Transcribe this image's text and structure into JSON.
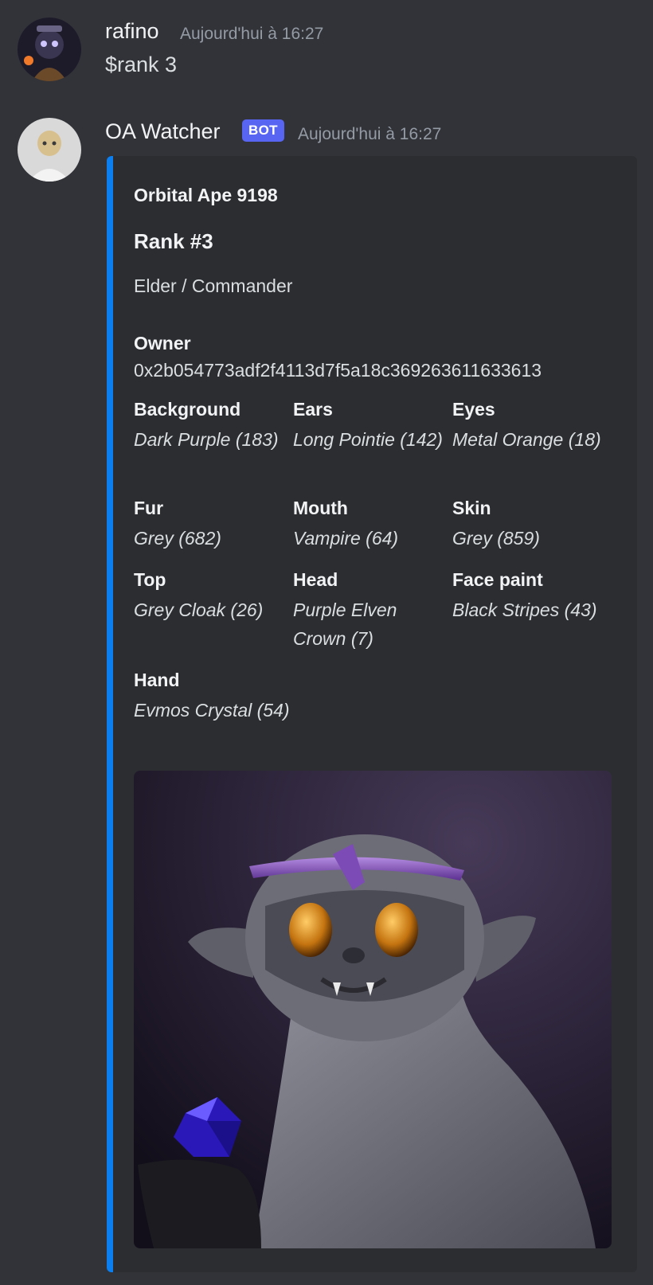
{
  "messages": [
    {
      "author": "rafino",
      "timestamp": "Aujourd'hui à 16:27",
      "content": "$rank 3"
    },
    {
      "author": "OA Watcher",
      "bot_tag": "BOT",
      "timestamp": "Aujourd'hui à 16:27",
      "embed": {
        "color": "#0b7ff0",
        "author": "Orbital Ape 9198",
        "title": "Rank #3",
        "description": "Elder / Commander",
        "owner": {
          "name": "Owner",
          "value": "0x2b054773adf2f4113d7f5a18c369263611633613"
        },
        "fields": [
          {
            "name": "Background",
            "value": "Dark Purple (183)"
          },
          {
            "name": "Ears",
            "value": "Long Pointie (142)"
          },
          {
            "name": "Eyes",
            "value": "Metal Orange (18)"
          },
          {
            "name": "Fur",
            "value": "Grey (682)"
          },
          {
            "name": "Mouth",
            "value": "Vampire (64)"
          },
          {
            "name": "Skin",
            "value": "Grey (859)"
          },
          {
            "name": "Top",
            "value": "Grey Cloak (26)"
          },
          {
            "name": "Head",
            "value": "Purple Elven Crown (7)"
          },
          {
            "name": "Face paint",
            "value": "Black Stripes (43)"
          },
          {
            "name": "Hand",
            "value": "Evmos Crystal (54)"
          }
        ]
      }
    }
  ]
}
